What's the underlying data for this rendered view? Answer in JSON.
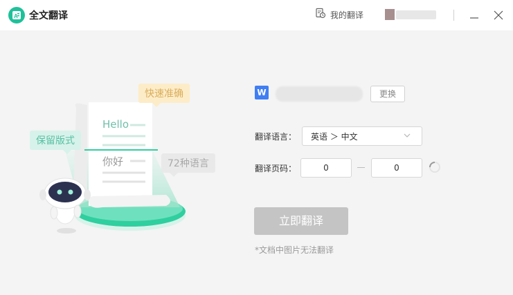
{
  "window": {
    "title": "全文翻译",
    "history_label": "我的翻译"
  },
  "illustration": {
    "bubble_fast": "快速准确",
    "bubble_keep_format": "保留版式",
    "bubble_languages": "72种语言",
    "paper_hello": "Hello",
    "paper_nihao": "你好"
  },
  "file": {
    "icon_letter": "W",
    "change_label": "更换"
  },
  "form": {
    "language_label": "翻译语言：",
    "language_value": "英语 ＞ 中文",
    "pages_label": "翻译页码：",
    "page_from": "0",
    "page_to": "0"
  },
  "actions": {
    "translate_label": "立即翻译",
    "note": "*文档中图片无法翻译"
  },
  "colors": {
    "accent": "#1fc19a",
    "button_disabled": "#c4c4c4",
    "word_blue": "#3f7ef3"
  }
}
